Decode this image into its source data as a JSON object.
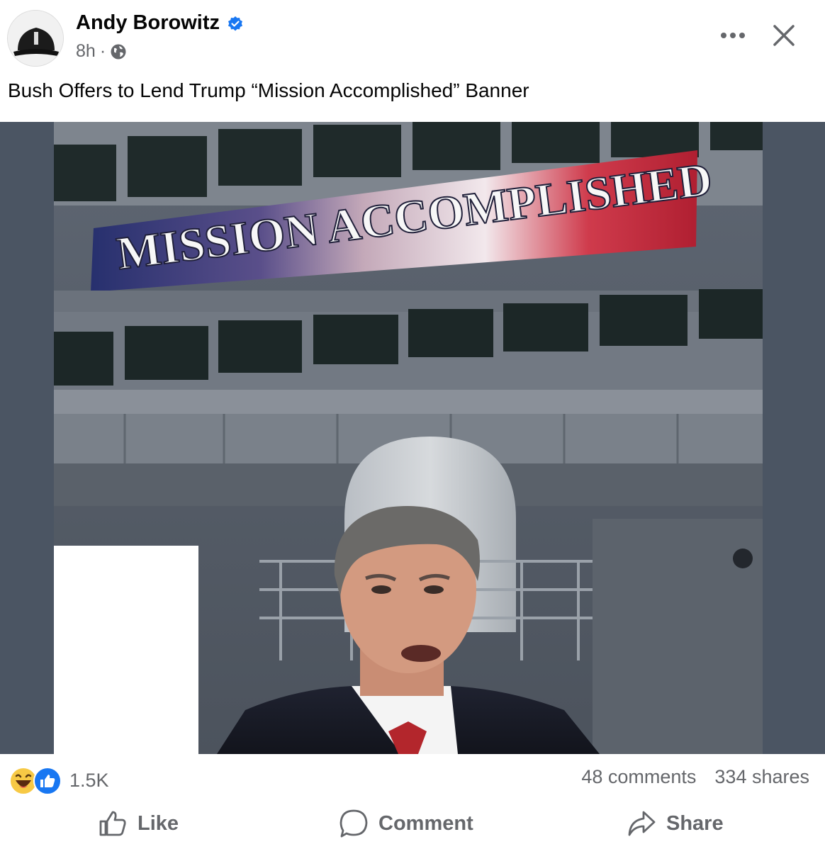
{
  "post": {
    "author": "Andy Borowitz",
    "time": "8h",
    "separator": "·",
    "text": "Bush Offers to Lend Trump “Mission Accomplished” Banner"
  },
  "photo": {
    "banner_text": "MISSION ACCOMPLISHED"
  },
  "stats": {
    "reactions": "1.5K",
    "comments": "48 comments",
    "shares": "334 shares"
  },
  "actions": {
    "like": "Like",
    "comment": "Comment",
    "share": "Share"
  },
  "icons": [
    "verified-badge-icon",
    "globe-icon",
    "more-options-icon",
    "close-icon",
    "haha-reaction-icon",
    "like-reaction-icon",
    "thumbs-up-icon",
    "comment-icon",
    "share-icon"
  ],
  "colors": {
    "accent": "#1877f2",
    "muted_text": "#65676b",
    "photo_background": "#4b5563"
  }
}
